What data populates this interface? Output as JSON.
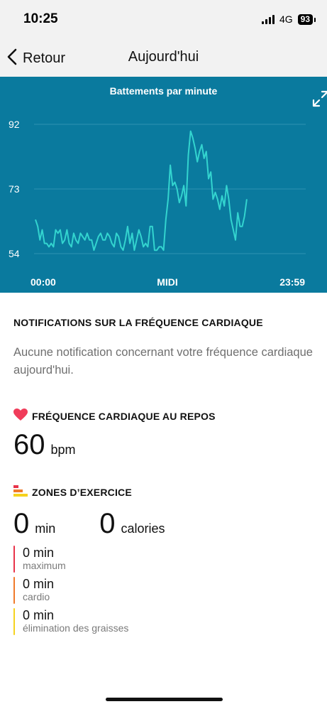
{
  "status_bar": {
    "time": "10:25",
    "network": "4G",
    "battery": "93"
  },
  "nav": {
    "back_label": "Retour",
    "title": "Aujourd'hui"
  },
  "chart_data": {
    "type": "line",
    "title": "Battements par minute",
    "y_ticks": [
      "92",
      "73",
      "54"
    ],
    "ylim": [
      54,
      92
    ],
    "x_ticks": [
      "00:00",
      "MIDI",
      "23:59"
    ],
    "grid": true,
    "color": "#33d4cf",
    "x_minutes": [
      0,
      12,
      24,
      36,
      48,
      60,
      72,
      84,
      96,
      108,
      120,
      132,
      144,
      156,
      168,
      180,
      192,
      204,
      216,
      228,
      240,
      252,
      264,
      276,
      288,
      300,
      312,
      324,
      336,
      348,
      360,
      372,
      384,
      396,
      408,
      420,
      432,
      444,
      456,
      468,
      480,
      492,
      504,
      516,
      528,
      540,
      552,
      564,
      576,
      588,
      600,
      612,
      624,
      636,
      648,
      660,
      672,
      684,
      696,
      708,
      720,
      732,
      744,
      756,
      768,
      780,
      792,
      804,
      816,
      828,
      840,
      852,
      864,
      876,
      888,
      900,
      912,
      924,
      936,
      948,
      960,
      972,
      984,
      996,
      1008,
      1020,
      1032,
      1044,
      1056,
      1068,
      1080,
      1092,
      1104,
      1116,
      1128
    ],
    "values": [
      64,
      62,
      58,
      61,
      57,
      57,
      56,
      57,
      56,
      61,
      60,
      61,
      57,
      58,
      61,
      57,
      56,
      60,
      58,
      57,
      60,
      59,
      58,
      60,
      58,
      58,
      55,
      57,
      59,
      60,
      58,
      58,
      60,
      59,
      57,
      56,
      60,
      59,
      56,
      55,
      58,
      62,
      57,
      60,
      55,
      58,
      61,
      59,
      56,
      57,
      56,
      62,
      62,
      55,
      55,
      56,
      56,
      55,
      64,
      70,
      80,
      74,
      75,
      73,
      69,
      71,
      74,
      68,
      83,
      90,
      88,
      85,
      81,
      84,
      86,
      82,
      84,
      76,
      78,
      70,
      72,
      70,
      67,
      71,
      68,
      74,
      70,
      64,
      61,
      58,
      66,
      62,
      62,
      65,
      70,
      71,
      68,
      73
    ]
  },
  "notifications": {
    "heading": "NOTIFICATIONS SUR LA FRÉQUENCE CARDIAQUE",
    "text": "Aucune notification concernant votre fréquence cardiaque aujourd'hui."
  },
  "resting": {
    "heading": "FRÉQUENCE CARDIAQUE AU REPOS",
    "value": "60",
    "unit": "bpm",
    "icon_color": "#f03c5a"
  },
  "zones": {
    "heading": "ZONES D’EXERCICE",
    "minutes_value": "0",
    "minutes_unit": "min",
    "calories_value": "0",
    "calories_unit": "calories",
    "items": [
      {
        "value": "0 min",
        "label": "maximum",
        "color": "#e8334a"
      },
      {
        "value": "0 min",
        "label": "cardio",
        "color": "#f07a2a"
      },
      {
        "value": "0 min",
        "label": "élimination des graisses",
        "color": "#f5d21e"
      }
    ]
  }
}
